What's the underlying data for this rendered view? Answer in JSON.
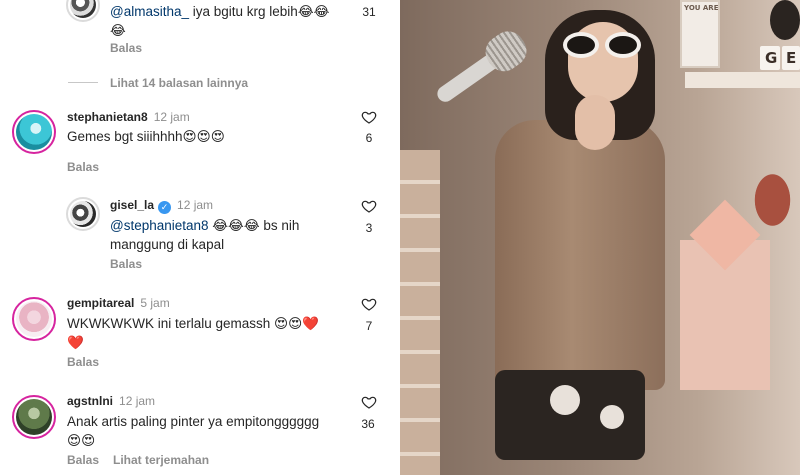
{
  "thread_top": {
    "handle": "@almasitha_",
    "text": " iya bgitu krg lebih",
    "emoji": "😂😂",
    "emoji_line2": "😂",
    "likes": "31",
    "reply": "Balas"
  },
  "view_more": "Lihat 14 balasan lainnya",
  "comments": [
    {
      "username": "stephanietan8",
      "time": "12 jam",
      "text": "Gemes bgt siiihhhh😍😍😍",
      "likes": "6",
      "reply": "Balas"
    },
    {
      "username": "gisel_la",
      "verified_mark": "✓",
      "time": "12 jam",
      "mention": "@stephanietan8",
      "text": " 😂😂😂 bs nih",
      "text_line2": "manggung di kapal",
      "likes": "3",
      "reply": "Balas"
    },
    {
      "username": "gempitareal",
      "time": "5 jam",
      "text": "WKWKWKWK ini terlalu gemassh 😍😍❤️",
      "text_line2": "❤️",
      "likes": "7",
      "reply": "Balas"
    },
    {
      "username": "agstnlni",
      "time": "12 jam",
      "text": "Anak artis paling pinter ya empitongggggg",
      "text_line2": "😍😍",
      "likes": "36",
      "reply": "Balas",
      "translate": "Lihat terjemahan"
    }
  ],
  "photo": {
    "shelf_letters": [
      "G",
      "E"
    ],
    "note": "YOU ARE"
  },
  "colors": {
    "text": "#262626",
    "muted": "#8e8e8e",
    "mention": "#00376b",
    "verified": "#3897f0",
    "story_ring": "#d6249f"
  }
}
